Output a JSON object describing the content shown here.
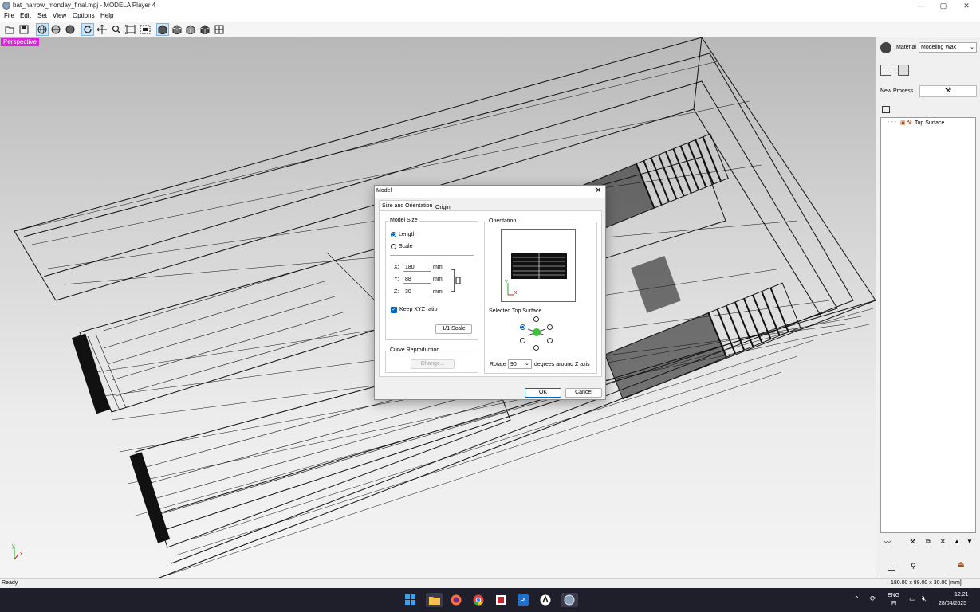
{
  "window": {
    "title": "bat_narrow_monday_final.mpj - MODELA Player 4",
    "minimize": "—",
    "maximize": "▢",
    "close": "✕"
  },
  "menu": [
    "File",
    "Edit",
    "Set",
    "View",
    "Options",
    "Help"
  ],
  "toolbar_icons": [
    "open-file-icon",
    "save-icon",
    "wireframe-view-icon",
    "rendered-view-icon",
    "sphere-view-icon",
    "rotate-icon",
    "pan-icon",
    "zoom-icon",
    "fit-icon",
    "zoom-area-icon",
    "view-top-icon",
    "view-front-icon",
    "view-side-icon",
    "view-iso-icon",
    "grid-view-icon"
  ],
  "viewport": {
    "label": "Perspective",
    "axes": {
      "x": "x",
      "y": "y"
    }
  },
  "right_panel": {
    "material_label": "Material",
    "material_value": "Modeling Wax",
    "new_process_label": "New Process",
    "tree_item": "Top Surface"
  },
  "dialog": {
    "title": "Model",
    "tabs": [
      "Size and Orientation",
      "Origin"
    ],
    "model_size": {
      "title": "Model Size",
      "length": "Length",
      "scale": "Scale",
      "x_label": "X:",
      "x_value": "180",
      "x_unit": "mm",
      "y_label": "Y:",
      "y_value": "88",
      "y_unit": "mm",
      "z_label": "Z:",
      "z_value": "30",
      "z_unit": "mm",
      "keep_ratio": "Keep XYZ ratio",
      "scale_button": "1/1 Scale"
    },
    "curve": {
      "title": "Curve Reproduction",
      "change_button": "Change..."
    },
    "orientation": {
      "title": "Orientation",
      "selected_top": "Selected Top Surface",
      "rotate_label": "Rotate",
      "rotate_value": "90",
      "rotate_suffix": "degrees around Z axis"
    },
    "ok": "OK",
    "cancel": "Cancel"
  },
  "status": {
    "left": "Ready",
    "right": "180.00 x 88.00 x 30.00 [mm]"
  },
  "taskbar": {
    "lang_top": "ENG",
    "lang_bottom": "FI",
    "time": "12.21",
    "date": "28/04/2025"
  }
}
